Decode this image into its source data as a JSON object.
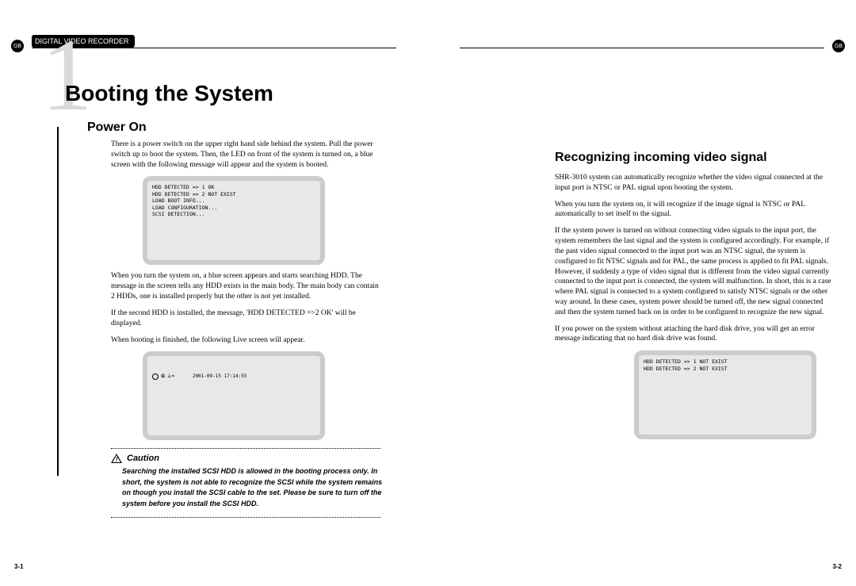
{
  "locale_badge": "GB",
  "running_header": "DIGITAL VIDEO RECORDER",
  "chapter_number_glyph": "1",
  "chapter_title": "Booting the System",
  "left": {
    "section1_title": "Power On",
    "para1": "There is a power switch on the upper right hand side behind the system. Pull the power switch up to boot the system. Then, the LED on front of the system is turned on, a blue screen with the following message will appear and the system is booted.",
    "screen1_lines": "HDD DETECTED => 1 OK\nHDD DETECTED => 2 NOT EXIST\nLOAD BOOT INFO...\nLOAD CONFIGURATION...\nSCSI DETECTION...",
    "para2": "When you turn the system on, a blue screen appears and starts searching HDD. The message in the screen tells any HDD exists in the main body. The main body can contain 2 HDDs, one is installed properly but the other is not yet installed.",
    "para3": "If the second HDD is installed, the message, 'HDD DETECTED =>2 OK' will be displayed.",
    "para4": "When booting is finished, the following Live screen will appear.",
    "live_timestamp": "2001-09-15 17:14:55",
    "caution_label": "Caution",
    "caution_text": "Searching the installed SCSI HDD is allowed in the booting process only. In short, the system is not able to recognize the SCSI while the system remains on though you install the SCSI cable to the set. Please be sure to turn off the system before you install the SCSI HDD.",
    "page_num": "3-1"
  },
  "right": {
    "section_title": "Recognizing incoming video signal",
    "para1": "SHR-3010 system can automatically recognize whether the video signal connected at the input port is NTSC or PAL signal upon booting the system.",
    "para2": "When you turn the system on, it will recognize if the image signal is NTSC or PAL automatically to set itself to the signal.",
    "para3": "If the system power is turned on without connecting video signals to the input port, the system remembers the last signal and the system is configured accordingly. For example, if the past video signal connected to the input port was an NTSC signal, the system is configured to fit NTSC signals and for PAL, the same process is applied to fit PAL signals. However, if suddenly a type of video signal that is different from the video signal currently connected to the input port is connected, the system will malfunction. In short, this is a case where PAL signal is connected to a system configured to satisfy NTSC signals or the other way around. In these cases, system power should be turned off, the new signal connected and then the system turned back on in order to be configured to recognize the new signal.",
    "para4": "If you power on the system without attaching the hard disk drive, you will get an error message indicating that no hard disk drive was found.",
    "screen_lines": "HDD DETECTED => 1 NOT EXIST\nHDD DETECTED => 2 NOT EXIST",
    "page_num": "3-2"
  }
}
